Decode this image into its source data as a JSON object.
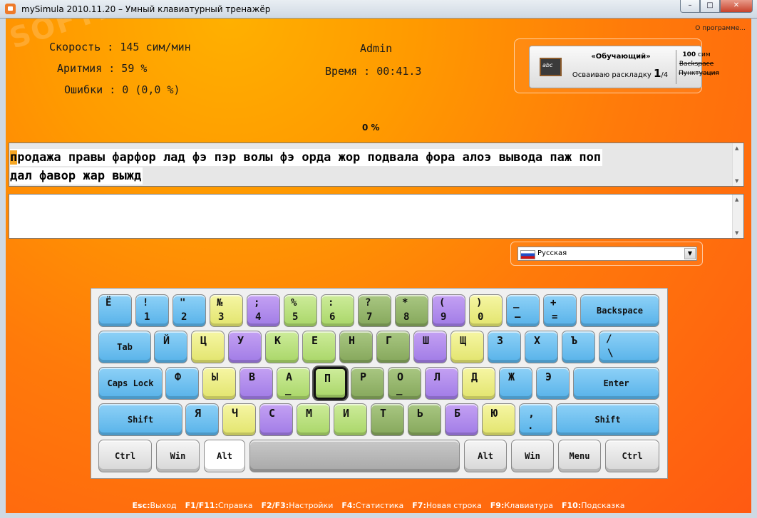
{
  "window": {
    "title": "mySimula 2010.11.20 – Умный клавиатурный тренажёр",
    "min": "–",
    "max": "□",
    "close": "✕"
  },
  "header": {
    "about": "О программе..."
  },
  "stats": {
    "speed": "Скорость : 145 сим/мин",
    "arrhythmia": "Аритмия : 59 %",
    "errors": "Ошибки : 0 (0,0 %)",
    "user": "Admin",
    "time": "Время : 00:41.3"
  },
  "watermark": "SOFTPORTAL",
  "mode": {
    "title": "«Обучающий»",
    "subtitle": "Осваиваю раскладку",
    "step": "1",
    "total": "/4",
    "chars_num": "100",
    "chars_unit": " сим",
    "backspace": "Backspace",
    "punctuation": "Пунктуация"
  },
  "progress": "0 %",
  "lesson": {
    "first_char": "п",
    "line1_rest": "родажа правы фарфор лад фэ пэр волы фэ орда жор подвала фора алоэ вывода паж поп",
    "line2": "дал фавор жар выжд"
  },
  "language": {
    "selected": "Русская"
  },
  "keyboard": {
    "row1": [
      {
        "t": "Ё",
        "b": "",
        "c": "blue"
      },
      {
        "t": "!",
        "b": "1",
        "c": "blue"
      },
      {
        "t": "\"",
        "b": "2",
        "c": "blue"
      },
      {
        "t": "№",
        "b": "3",
        "c": "yellow"
      },
      {
        "t": ";",
        "b": "4",
        "c": "purple"
      },
      {
        "t": "%",
        "b": "5",
        "c": "lgreen"
      },
      {
        "t": ":",
        "b": "6",
        "c": "lgreen"
      },
      {
        "t": "?",
        "b": "7",
        "c": "dgreen"
      },
      {
        "t": "*",
        "b": "8",
        "c": "dgreen"
      },
      {
        "t": "(",
        "b": "9",
        "c": "purple"
      },
      {
        "t": ")",
        "b": "0",
        "c": "yellow"
      },
      {
        "t": "_",
        "b": "–",
        "c": "blue"
      },
      {
        "t": "+",
        "b": "=",
        "c": "blue"
      }
    ],
    "backspace": "Backspace",
    "tab": "Tab",
    "row2": [
      {
        "l": "Й",
        "c": "blue"
      },
      {
        "l": "Ц",
        "c": "yellow"
      },
      {
        "l": "У",
        "c": "purple"
      },
      {
        "l": "К",
        "c": "lgreen"
      },
      {
        "l": "Е",
        "c": "lgreen"
      },
      {
        "l": "Н",
        "c": "dgreen"
      },
      {
        "l": "Г",
        "c": "dgreen"
      },
      {
        "l": "Ш",
        "c": "purple"
      },
      {
        "l": "Щ",
        "c": "yellow"
      },
      {
        "l": "З",
        "c": "blue"
      },
      {
        "l": "Х",
        "c": "blue"
      },
      {
        "l": "Ъ",
        "c": "blue"
      }
    ],
    "slash": {
      "t": "/",
      "b": "\\"
    },
    "capslock": "Caps Lock",
    "row3": [
      {
        "l": "Ф",
        "c": "blue"
      },
      {
        "l": "Ы",
        "c": "yellow"
      },
      {
        "l": "В",
        "c": "purple"
      },
      {
        "l": "А",
        "c": "lgreen",
        "mark": "_"
      },
      {
        "l": "П",
        "c": "lgreen",
        "active": true
      },
      {
        "l": "Р",
        "c": "dgreen"
      },
      {
        "l": "О",
        "c": "dgreen",
        "mark": "_"
      },
      {
        "l": "Л",
        "c": "purple"
      },
      {
        "l": "Д",
        "c": "yellow"
      },
      {
        "l": "Ж",
        "c": "blue"
      },
      {
        "l": "Э",
        "c": "blue"
      }
    ],
    "enter": "Enter",
    "shift": "Shift",
    "row4": [
      {
        "l": "Я",
        "c": "blue"
      },
      {
        "l": "Ч",
        "c": "yellow"
      },
      {
        "l": "С",
        "c": "purple"
      },
      {
        "l": "М",
        "c": "lgreen"
      },
      {
        "l": "И",
        "c": "lgreen"
      },
      {
        "l": "Т",
        "c": "dgreen"
      },
      {
        "l": "Ь",
        "c": "dgreen"
      },
      {
        "l": "Б",
        "c": "purple"
      },
      {
        "l": "Ю",
        "c": "yellow"
      },
      {
        "l": ",",
        "b": ".",
        "c": "blue"
      }
    ],
    "ctrl": "Ctrl",
    "win": "Win",
    "alt": "Alt",
    "menu": "Menu"
  },
  "footer": [
    {
      "k": "Esc:",
      "v": "Выход"
    },
    {
      "k": "F1/F11:",
      "v": "Справка"
    },
    {
      "k": "F2/F3:",
      "v": "Настройки"
    },
    {
      "k": "F4:",
      "v": "Статистика"
    },
    {
      "k": "F7:",
      "v": "Новая строка"
    },
    {
      "k": "F9:",
      "v": "Клавиатура"
    },
    {
      "k": "F10:",
      "v": "Подсказка"
    }
  ]
}
